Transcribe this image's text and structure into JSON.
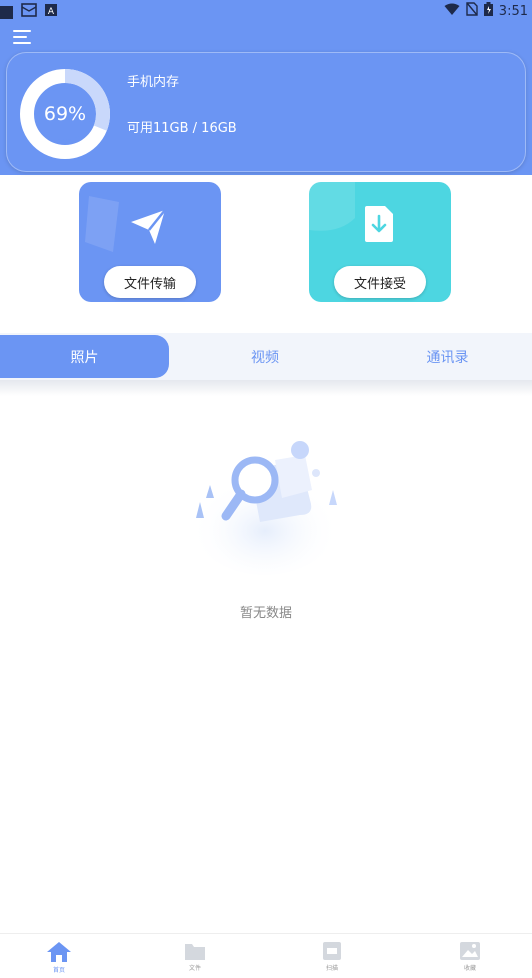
{
  "status_bar": {
    "time": "3:51"
  },
  "storage": {
    "title": "手机内存",
    "percent_label": "69%",
    "percent_value": 69,
    "usage_text": "可用11GB / 16GB"
  },
  "actions": [
    {
      "label": "文件传输",
      "icon": "paper-plane-icon"
    },
    {
      "label": "文件接受",
      "icon": "file-download-icon"
    }
  ],
  "tabs": [
    {
      "label": "照片",
      "active": true
    },
    {
      "label": "视频",
      "active": false
    },
    {
      "label": "通讯录",
      "active": false
    }
  ],
  "empty_state": {
    "text": "暂无数据",
    "icon": "magnifier-document-icon"
  },
  "bottom_nav": [
    {
      "label": "首页",
      "icon": "home-icon",
      "active": true
    },
    {
      "label": "文件",
      "icon": "folder-icon",
      "active": false
    },
    {
      "label": "扫描",
      "icon": "scan-icon",
      "active": false
    },
    {
      "label": "收藏",
      "icon": "image-icon",
      "active": false
    }
  ],
  "colors": {
    "primary": "#6b95f3",
    "teal": "#4dd6e1",
    "tab_bg": "#f2f5fb"
  }
}
